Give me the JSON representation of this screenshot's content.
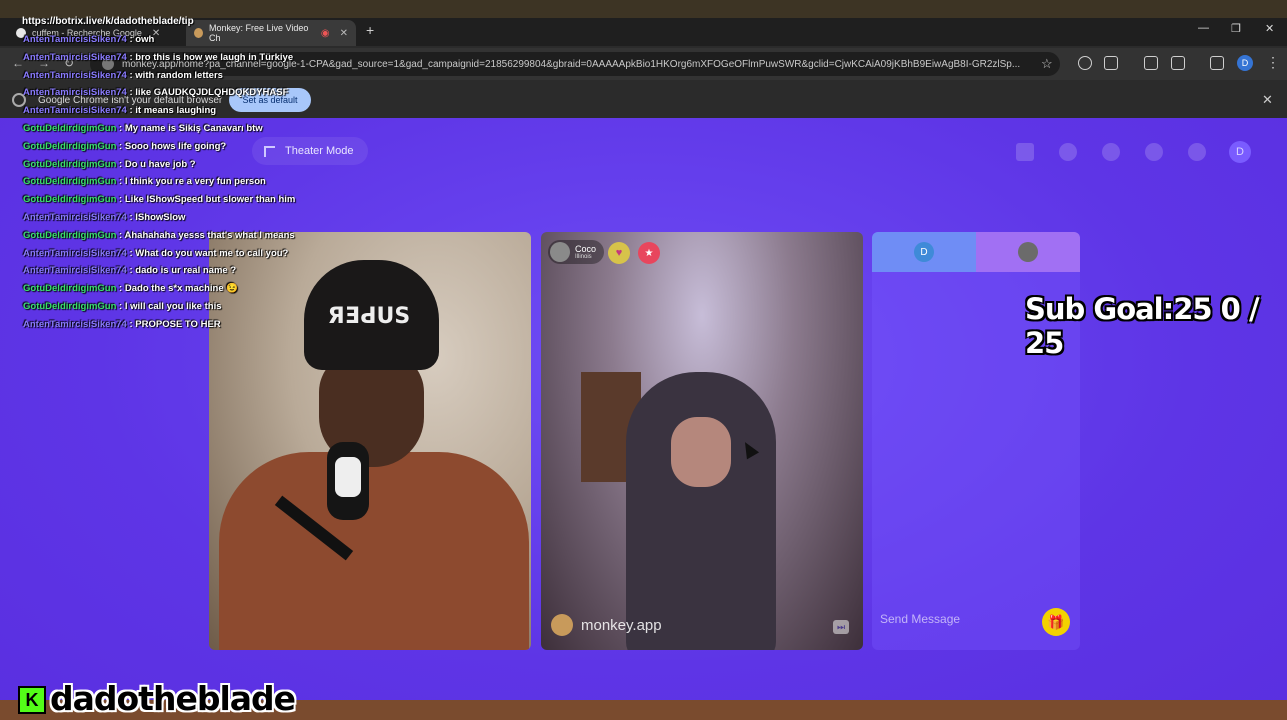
{
  "browser": {
    "tabs": [
      {
        "title": "cuffem - Recherche Google"
      },
      {
        "title": "Monkey: Free Live Video Ch"
      }
    ],
    "new_tab": "+",
    "url": "monkey.app/home?pa_channel=google-1-CPA&gad_source=1&gad_campaignid=21856299804&gbraid=0AAAAApkBio1HKOrg6mXFOGeOFlmPuwSWR&gclid=CjwKCAiA09jKBhB9EiwAgB8I-GR2zlSp...",
    "profile_initial": "D",
    "infobar": {
      "message": "Google Chrome isn't your default browser",
      "button": "Set as default"
    }
  },
  "page": {
    "theater_button": "Theater Mode",
    "user_initial": "D",
    "partner": {
      "name": "Coco",
      "location": "Illinois"
    },
    "watermark": "monkey.app",
    "chat_panel": {
      "self_initial": "D",
      "input_placeholder": "Send Message"
    }
  },
  "overlay": {
    "tip_url": "https://botrix.live/k/dadotheblade/tip",
    "sub_goal": "Sub Goal:25  0 / 25",
    "streamer_name": "dadotheblade",
    "kick_logo": "K",
    "chat": [
      {
        "user": "AntenTamircisiSiken74",
        "msg": "owh",
        "c": "a"
      },
      {
        "user": "AntenTamircisiSiken74",
        "msg": "bro this is how we laugh in Türkiye",
        "c": "a"
      },
      {
        "user": "AntenTamircisiSiken74",
        "msg": "with random letters",
        "c": "a"
      },
      {
        "user": "AntenTamircisiSiken74",
        "msg": "like GAUDKQJDLQHDQKDYHASF",
        "c": "a"
      },
      {
        "user": "AntenTamircisiSiken74",
        "msg": "it means laughing",
        "c": "a"
      },
      {
        "user": "GotuDeldirdigimGun",
        "msg": "My name is Sikiş Canavarı btw",
        "c": "b"
      },
      {
        "user": "GotuDeldirdigimGun",
        "msg": "Sooo hows life going?",
        "c": "b"
      },
      {
        "user": "GotuDeldirdigimGun",
        "msg": "Do u have job ?",
        "c": "b"
      },
      {
        "user": "GotuDeldirdigimGun",
        "msg": "I think you re a very fun person",
        "c": "b"
      },
      {
        "user": "GotuDeldirdigimGun",
        "msg": "Like IShowSpeed but slower than him",
        "c": "b"
      },
      {
        "user": "AntenTamircisiSiken74",
        "msg": "IShowSlow",
        "c": "a"
      },
      {
        "user": "GotuDeldirdigimGun",
        "msg": "Ahahahaha yesss that's what I means",
        "c": "b"
      },
      {
        "user": "AntenTamircisiSiken74",
        "msg": "What do you want me to call you?",
        "c": "a"
      },
      {
        "user": "AntenTamircisiSiken74",
        "msg": "dado is ur real name ?",
        "c": "a"
      },
      {
        "user": "GotuDeldirdigimGun",
        "msg": "Dado the s*x machine 😉",
        "c": "b"
      },
      {
        "user": "GotuDeldirdigimGun",
        "msg": "I will call you like this",
        "c": "b"
      },
      {
        "user": "AntenTamircisiSiken74",
        "msg": "PROPOSE TO HER",
        "c": "a"
      }
    ]
  },
  "icons": {
    "heart": "heart-icon",
    "gift": "gift-icon",
    "skip": "skip-icon"
  }
}
